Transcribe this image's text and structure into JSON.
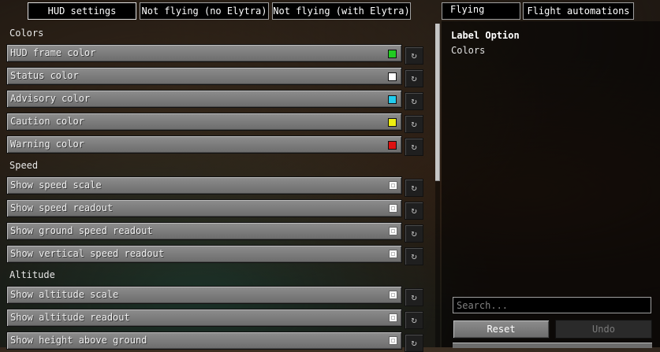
{
  "category_tabs": [
    {
      "label": "HUD settings"
    },
    {
      "label": "Not flying (no Elytra)"
    },
    {
      "label": "Not flying (with Elytra)"
    },
    {
      "label": "Flying"
    },
    {
      "label": "Flight automations"
    }
  ],
  "sections": [
    {
      "title": "Colors",
      "entries": [
        {
          "label": "HUD frame color",
          "type": "color",
          "color": "#22cc22"
        },
        {
          "label": "Status color",
          "type": "color",
          "color": "#ffffff"
        },
        {
          "label": "Advisory color",
          "type": "color",
          "color": "#22ccee"
        },
        {
          "label": "Caution color",
          "type": "color",
          "color": "#eeee11"
        },
        {
          "label": "Warning color",
          "type": "color",
          "color": "#dd1111"
        }
      ]
    },
    {
      "title": "Speed",
      "entries": [
        {
          "label": "Show speed scale",
          "type": "toggle",
          "checked": true
        },
        {
          "label": "Show speed readout",
          "type": "toggle",
          "checked": true
        },
        {
          "label": "Show ground speed readout",
          "type": "toggle",
          "checked": true
        },
        {
          "label": "Show vertical speed readout",
          "type": "toggle",
          "checked": true
        }
      ]
    },
    {
      "title": "Altitude",
      "entries": [
        {
          "label": "Show altitude scale",
          "type": "toggle",
          "checked": true
        },
        {
          "label": "Show altitude readout",
          "type": "toggle",
          "checked": true
        },
        {
          "label": "Show height above ground",
          "type": "toggle",
          "checked": true
        }
      ]
    }
  ],
  "reset_glyph": "↻",
  "details": {
    "title": "Label Option",
    "value": "Colors"
  },
  "search": {
    "placeholder": "Search..."
  },
  "buttons": {
    "reset": "Reset",
    "undo": "Undo"
  }
}
